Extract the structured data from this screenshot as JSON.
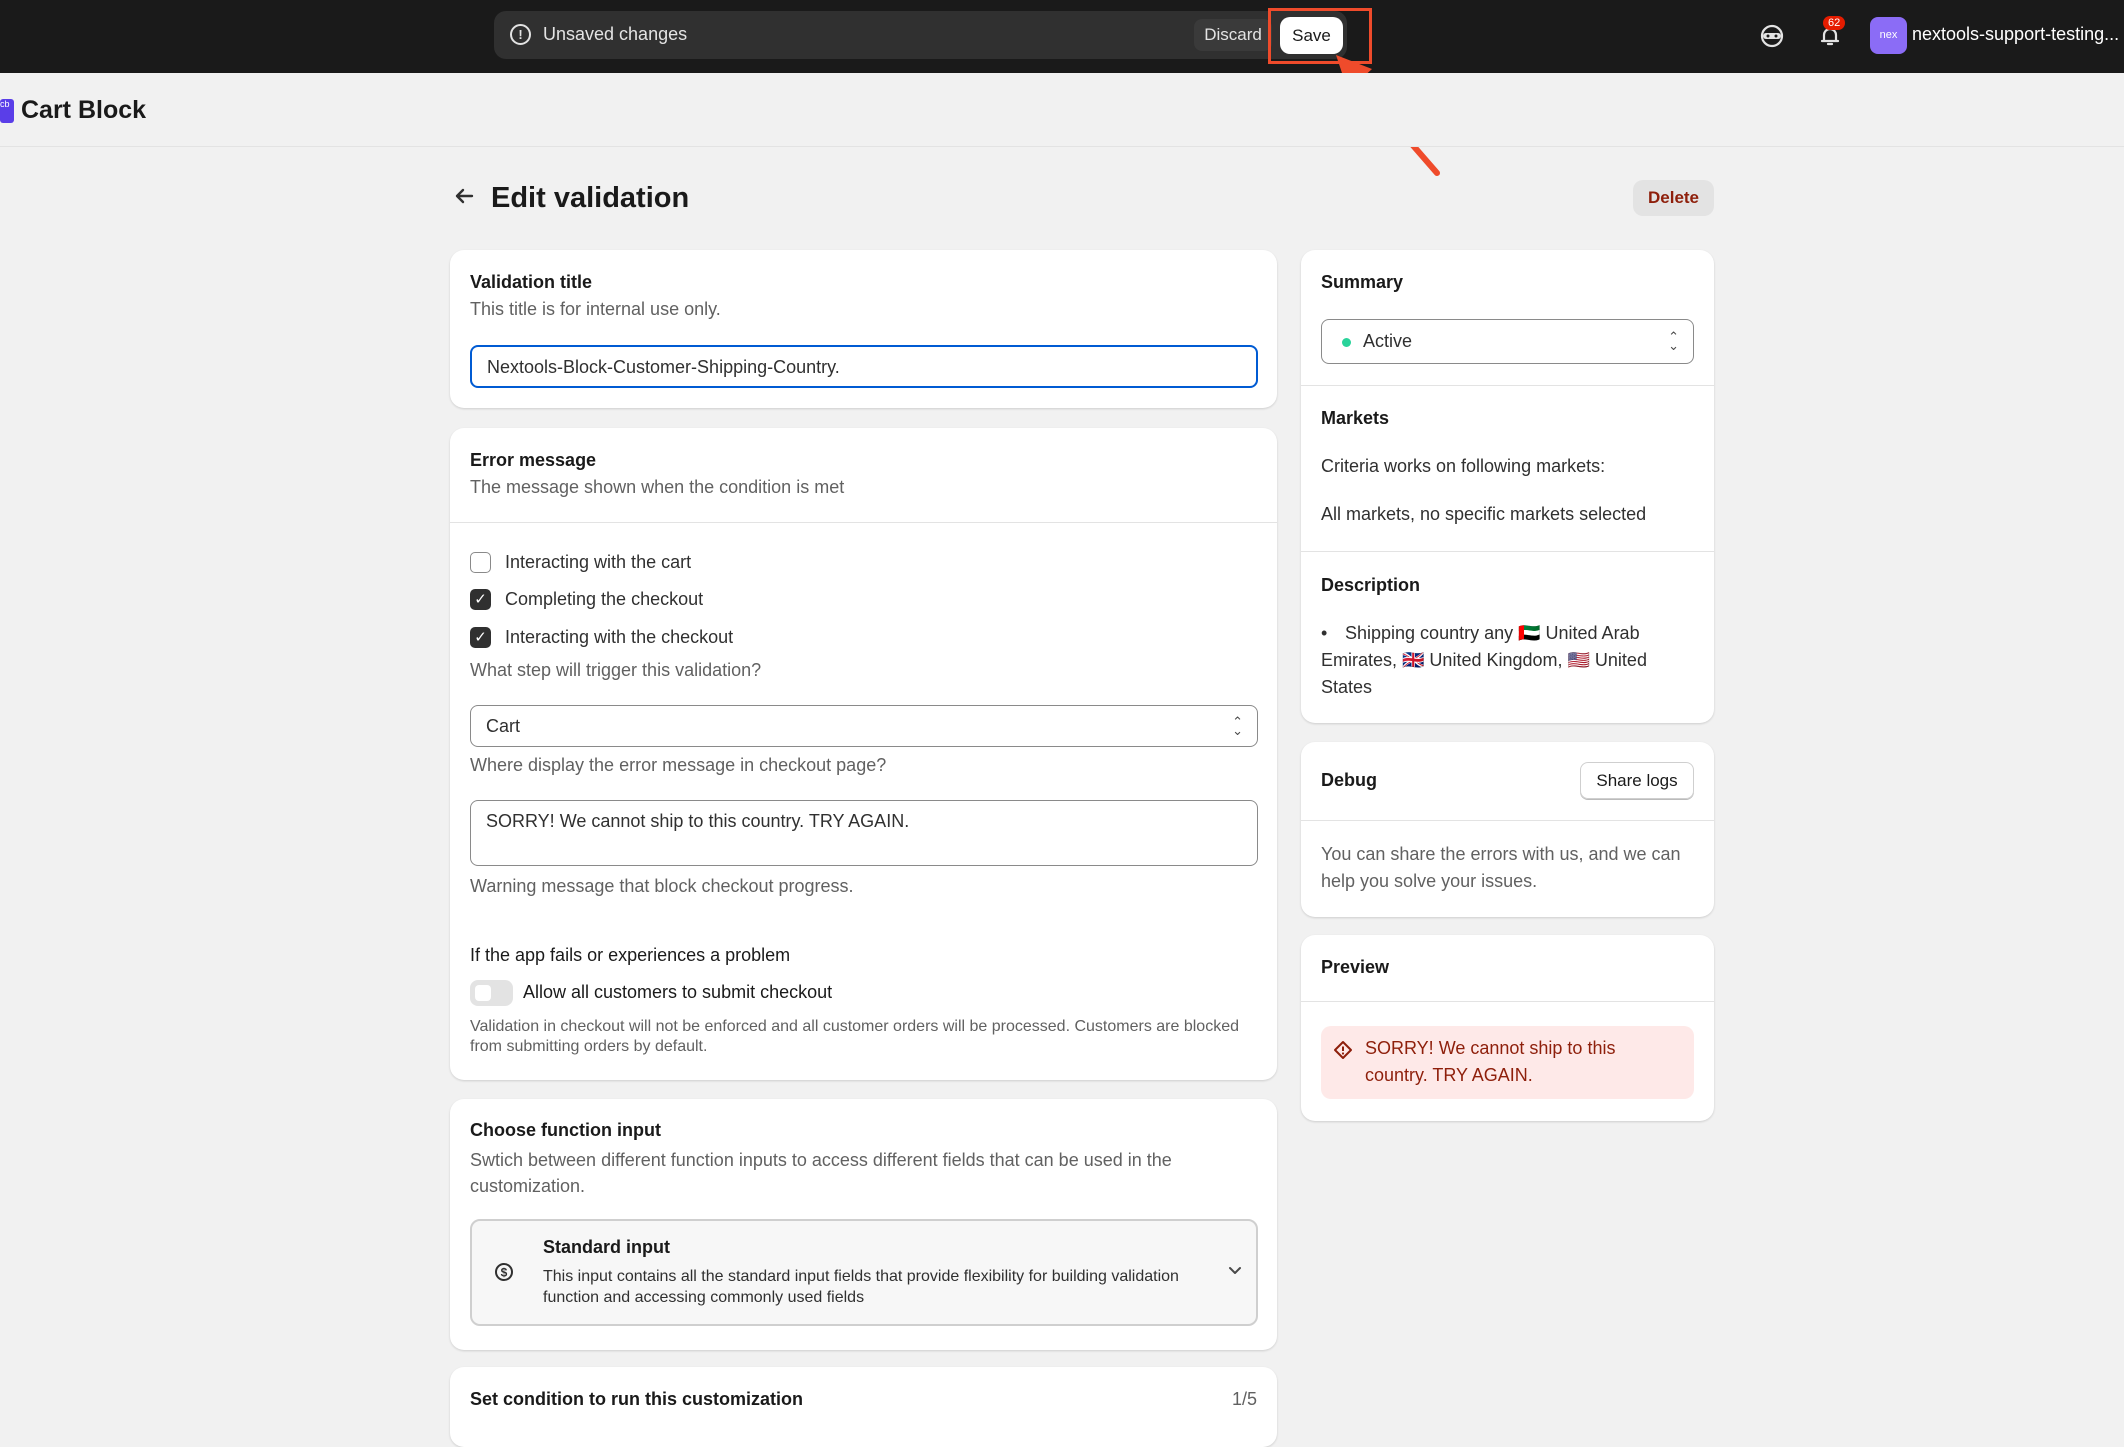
{
  "topbar": {
    "unsaved_label": "Unsaved changes",
    "discard_label": "Discard",
    "save_label": "Save",
    "notification_count": "62",
    "store_avatar": "nex",
    "store_name": "nextools-support-testing..."
  },
  "app": {
    "logo": "cb",
    "title": "Cart Block"
  },
  "page": {
    "title": "Edit validation",
    "delete_label": "Delete"
  },
  "validation_title": {
    "heading": "Validation title",
    "help": "This title is for internal use only.",
    "value": "Nextools-Block-Customer-Shipping-Country."
  },
  "error_message": {
    "heading": "Error message",
    "help": "The message shown when the condition is met",
    "checkboxes": [
      {
        "label": "Interacting with the cart",
        "checked": false
      },
      {
        "label": "Completing the checkout",
        "checked": true
      },
      {
        "label": "Interacting with the checkout",
        "checked": true
      }
    ],
    "trigger_help": "What step will trigger this validation?",
    "display_select": "Cart",
    "display_help": "Where display the error message in checkout page?",
    "message_value": "SORRY! We cannot ship to this country. TRY AGAIN.",
    "message_help": "Warning message that block checkout progress.",
    "fail_heading": "If the app fails or experiences a problem",
    "toggle_label": "Allow all customers to submit checkout",
    "toggle_on": false,
    "toggle_help": "Validation in checkout will not be enforced and all customer orders will be processed. Customers are blocked from submitting orders by default."
  },
  "function_input": {
    "heading": "Choose function input",
    "help": "Swtich between different function inputs to access different fields that can be used in the customization.",
    "option_title": "Standard input",
    "option_desc": "This input contains all the standard input fields that provide flexibility for building validation function and accessing commonly used fields"
  },
  "condition": {
    "heading": "Set condition to run this customization",
    "count": "1/5"
  },
  "summary": {
    "heading": "Summary",
    "status": "Active",
    "status_color": "#29d39a",
    "markets_heading": "Markets",
    "markets_line1": "Criteria works on following markets:",
    "markets_line2": "All markets, no specific markets selected",
    "description_heading": "Description",
    "description_line1": "Shipping country any 🇦🇪 United Arab",
    "description_line2": "Emirates, 🇬🇧 United Kingdom, 🇺🇸 United",
    "description_line3": "States"
  },
  "debug": {
    "heading": "Debug",
    "share_label": "Share logs",
    "text_line1": "You can share the errors with us, and we can",
    "text_line2": "help you solve your issues."
  },
  "preview": {
    "heading": "Preview",
    "line1": "SORRY! We cannot ship to this",
    "line2": "country. TRY AGAIN."
  },
  "icons": {
    "alert": "alert-circle-icon",
    "back": "arrow-left-icon",
    "chevron": "chevron-down-icon",
    "dollar": "dollar-circle-icon",
    "diamond_alert": "alert-diamond-icon",
    "bell": "bell-icon",
    "ninja": "ninja-icon"
  },
  "colors": {
    "annotation": "#ef4b2b",
    "critical_text": "#8e1f0b",
    "critical_bg": "#fee9e8"
  }
}
